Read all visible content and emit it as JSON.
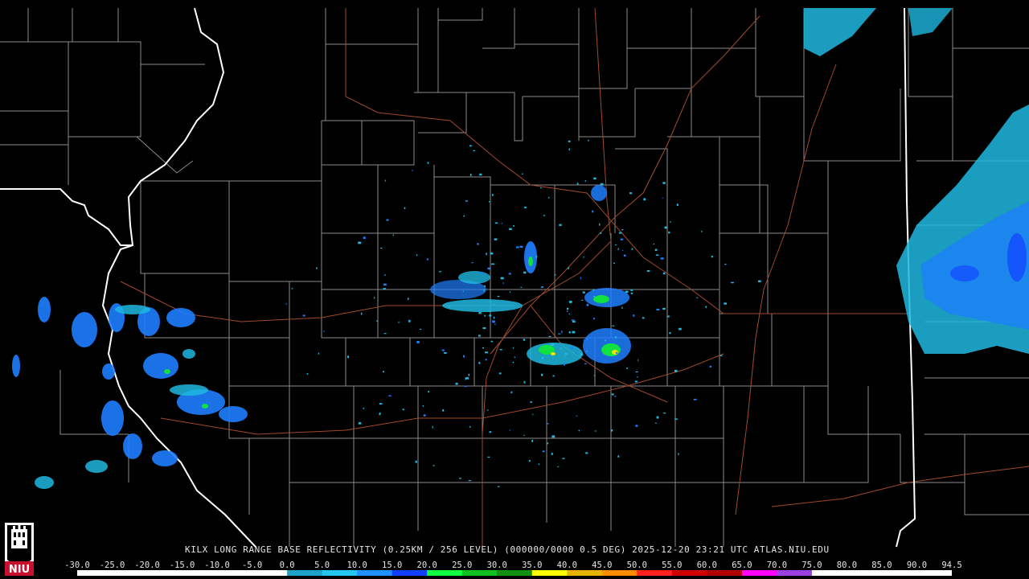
{
  "caption": "KILX LONG RANGE BASE REFLECTIVITY (0.25KM / 256 LEVEL) (000000/0000 0.5 DEG) 2025-12-20 23:21 UTC  ATLAS.NIU.EDU",
  "scale": {
    "ticks": [
      "-30.0",
      "-25.0",
      "-20.0",
      "-15.0",
      "-10.0",
      "-5.0",
      "0.0",
      "5.0",
      "10.0",
      "15.0",
      "20.0",
      "25.0",
      "30.0",
      "35.0",
      "40.0",
      "45.0",
      "50.0",
      "55.0",
      "60.0",
      "65.0",
      "70.0",
      "75.0",
      "80.0",
      "85.0",
      "90.0",
      "94.5"
    ],
    "colors": [
      "#ffffff",
      "#ffffff",
      "#ffffff",
      "#ffffff",
      "#ffffff",
      "#ffffff",
      "#1fa0c8",
      "#22c6f0",
      "#2090ff",
      "#1040ff",
      "#10ff40",
      "#10c020",
      "#109010",
      "#ffff00",
      "#e6b400",
      "#ff8c00",
      "#ff2020",
      "#d00000",
      "#b00000",
      "#ff00ff",
      "#9a40e0",
      "#ffffff",
      "#ffffff",
      "#ffffff",
      "#ffffff"
    ]
  },
  "logo": {
    "text": "NIU",
    "colors": {
      "shield": "#ffffff",
      "panel": "#c8102e"
    }
  },
  "map_colors": {
    "county_borders": "#8c8c8c",
    "state_borders": "#ffffff",
    "highways": "#a04a2a",
    "echo_light": "#1fb8e0",
    "echo_moderate": "#1e7fff",
    "echo_heavy": "#10e040",
    "echo_intense": "#ffe000"
  }
}
